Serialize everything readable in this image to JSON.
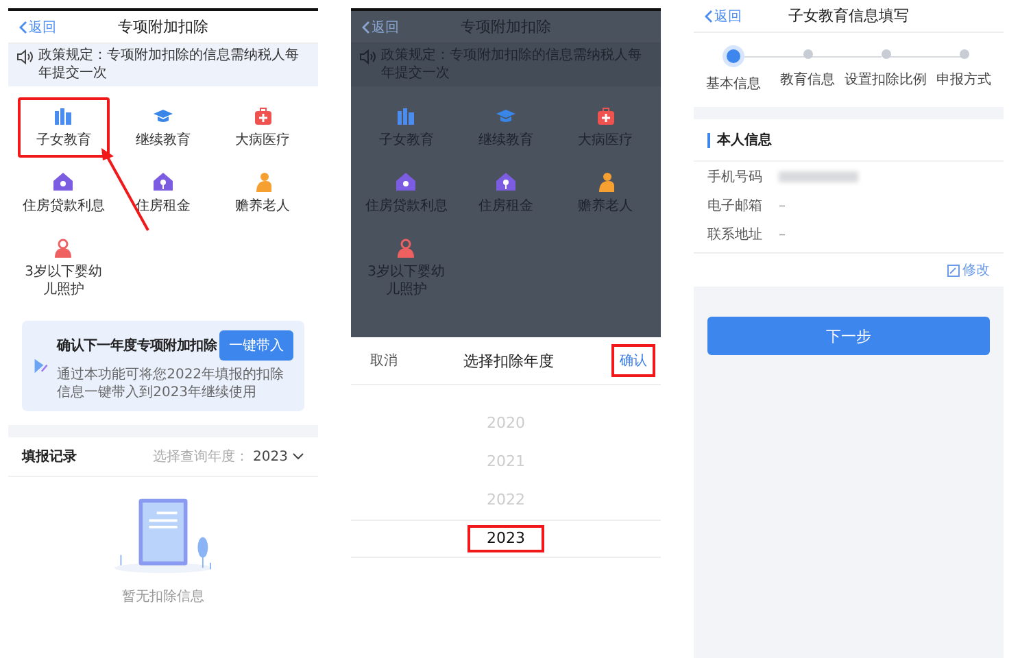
{
  "deduction_page": {
    "back": "返回",
    "title": "专项附加扣除",
    "notice": "政策规定：专项附加扣除的信息需纳税人每年提交一次",
    "items": [
      {
        "label": "子女教育",
        "color": "#4a8cf0",
        "highlighted": true
      },
      {
        "label": "继续教育",
        "color": "#3a86e8",
        "highlighted": false
      },
      {
        "label": "大病医疗",
        "color": "#ef5350",
        "highlighted": false
      },
      {
        "label": "住房贷款利息",
        "color": "#7c5ce0",
        "highlighted": false
      },
      {
        "label": "住房租金",
        "color": "#7c5ce0",
        "highlighted": false
      },
      {
        "label": "赡养老人",
        "color": "#f5a030",
        "highlighted": false
      },
      {
        "label": "3岁以下婴幼儿照护",
        "color": "#ef6060",
        "highlighted": false
      }
    ],
    "card": {
      "title": "确认下一年度**专项附加扣除**",
      "button": "一键带入",
      "text": "通过本功能可将您2022年填报的扣除信息一键带入到2023年继续使用"
    },
    "records": {
      "title": "填报记录",
      "filter_label": "选择查询年度：",
      "filter_value": "2023",
      "empty_text": "暂无扣除信息"
    }
  },
  "year_picker_page": {
    "background": {
      "back": "返回",
      "title": "专项附加扣除",
      "notice": "政策规定：专项附加扣除的信息需纳税人每年提交一次",
      "items": [
        {
          "label": "子女教育",
          "color": "#4a8cf0"
        },
        {
          "label": "继续教育",
          "color": "#3a86e8"
        },
        {
          "label": "大病医疗",
          "color": "#ef5350"
        },
        {
          "label": "住房贷款利息",
          "color": "#7c5ce0"
        },
        {
          "label": "住房租金",
          "color": "#7c5ce0"
        },
        {
          "label": "赡养老人",
          "color": "#f5a030"
        },
        {
          "label": "3岁以下婴幼儿照护",
          "color": "#ef6060"
        }
      ]
    },
    "picker": {
      "cancel": "取消",
      "title": "选择扣除年度",
      "confirm": "确认",
      "confirm_highlighted": true,
      "years": [
        {
          "label": "2020",
          "selected": false,
          "highlighted": false
        },
        {
          "label": "2021",
          "selected": false,
          "highlighted": false
        },
        {
          "label": "2022",
          "selected": false,
          "highlighted": false
        },
        {
          "label": "2023",
          "selected": true,
          "highlighted": true
        }
      ]
    }
  },
  "child_education_page": {
    "back": "返回",
    "title": "子女教育信息填写",
    "steps": [
      {
        "label": "基本信息",
        "selected": true
      },
      {
        "label": "教育信息",
        "selected": false
      },
      {
        "label": "设置扣除比例",
        "selected": false
      },
      {
        "label": "申报方式",
        "selected": false
      }
    ],
    "section": "本人信息",
    "fields": [
      {
        "label": "手机号码",
        "blurred": true
      },
      {
        "label": "电子邮箱",
        "value": "–",
        "blurred": false
      },
      {
        "label": "联系地址",
        "value": "–",
        "blurred": false
      }
    ],
    "edit": "修改",
    "next": "下一步"
  }
}
